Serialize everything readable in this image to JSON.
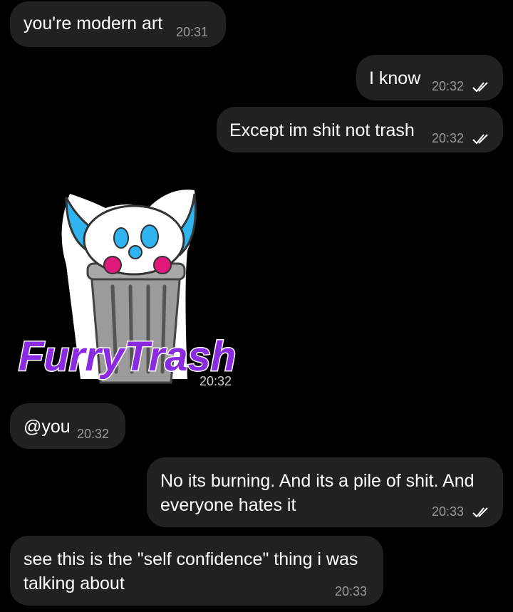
{
  "messages": [
    {
      "text": "you're modern art",
      "time": "20:31",
      "outgoing": false
    },
    {
      "text": "I know",
      "time": "20:32",
      "outgoing": true,
      "read": true
    },
    {
      "text": "Except im shit not trash",
      "time": "20:32",
      "outgoing": true,
      "read": true
    },
    {
      "sticker": "furry-trash",
      "sticker_text": "FurryTrash",
      "time": "20:32",
      "outgoing": false
    },
    {
      "text": "@you",
      "time": "20:32",
      "outgoing": false
    },
    {
      "text": "No its burning. And its a pile of shit. And everyone hates it",
      "time": "20:33",
      "outgoing": true,
      "read": true
    },
    {
      "text": "see this is the \"self confidence\" thing i was talking about",
      "time": "20:33",
      "outgoing": false
    }
  ],
  "colors": {
    "background": "#000000",
    "bubble": "#212121",
    "timestamp": "#9a9a9a",
    "sticker_text": "#8a2be2"
  },
  "icons": [
    "double-check-icon"
  ]
}
